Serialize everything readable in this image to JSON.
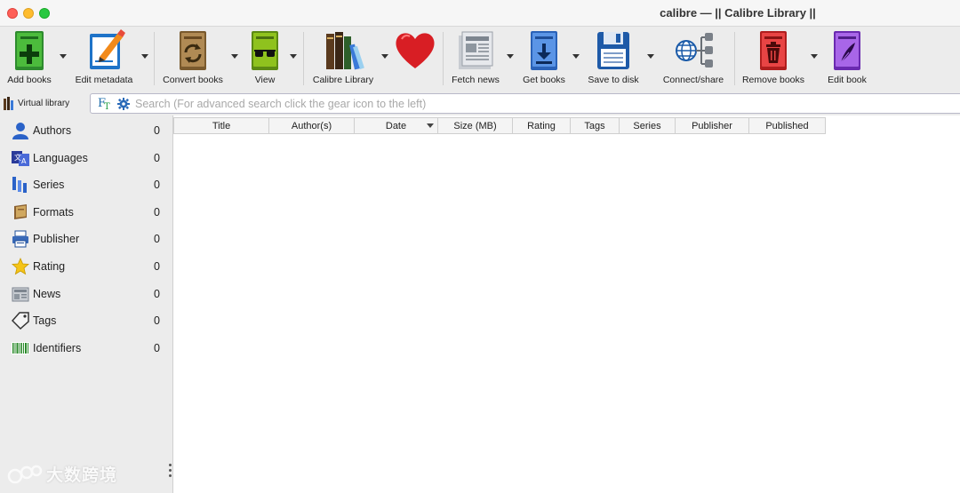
{
  "window": {
    "title": "calibre — || Calibre Library ||"
  },
  "toolbar": {
    "add_books": "Add books",
    "edit_metadata": "Edit metadata",
    "convert_books": "Convert books",
    "view": "View",
    "calibre_library": "Calibre Library",
    "fetch_news": "Fetch news",
    "get_books": "Get books",
    "save_to_disk": "Save to disk",
    "connect_share": "Connect/share",
    "remove_books": "Remove books",
    "edit_book": "Edit book"
  },
  "search": {
    "virtual_library": "Virtual library",
    "placeholder": "Search (For advanced search click the gear icon to the left)"
  },
  "tag_browser": [
    {
      "label": "Authors",
      "count": "0"
    },
    {
      "label": "Languages",
      "count": "0"
    },
    {
      "label": "Series",
      "count": "0"
    },
    {
      "label": "Formats",
      "count": "0"
    },
    {
      "label": "Publisher",
      "count": "0"
    },
    {
      "label": "Rating",
      "count": "0"
    },
    {
      "label": "News",
      "count": "0"
    },
    {
      "label": "Tags",
      "count": "0"
    },
    {
      "label": "Identifiers",
      "count": "0"
    }
  ],
  "columns": [
    "Title",
    "Author(s)",
    "Date",
    "Size (MB)",
    "Rating",
    "Tags",
    "Series",
    "Publisher",
    "Published"
  ],
  "sorted_column": "Date",
  "watermark": "大数跨境",
  "colors": {
    "window_bg": "#ececec",
    "list_bg": "#ffffff",
    "search_border": "#b8b8c8",
    "heart": "#d81e24"
  }
}
